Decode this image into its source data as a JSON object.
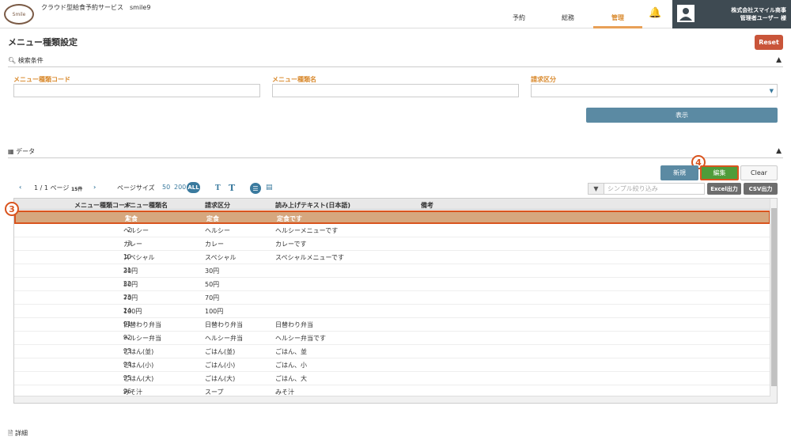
{
  "header": {
    "logo_text": "Smile",
    "app_title": "クラウド型給食予約サービス　smile9",
    "nav": [
      "予約",
      "総務",
      "管理"
    ],
    "active_nav": "管理",
    "company": "株式会社スマイル商事",
    "user": "管理者ユーザー 様"
  },
  "page": {
    "title": "メニュー種類設定",
    "reset_label": "Reset"
  },
  "search": {
    "section_title": "検索条件",
    "fields": [
      {
        "label": "メニュー種類コード",
        "value": ""
      },
      {
        "label": "メニュー種類名",
        "value": ""
      },
      {
        "label": "請求区分",
        "value": ""
      }
    ],
    "show_label": "表示"
  },
  "data_section": {
    "title": "データ",
    "new_label": "新規",
    "edit_label": "編集",
    "clear_label": "Clear",
    "callouts": [
      "3",
      "4"
    ],
    "pager_text": "1 / 1 ページ",
    "count_text": "15件",
    "page_size_label": "ページサイズ",
    "page_sizes": [
      "50",
      "200",
      "ALL"
    ],
    "filter_placeholder": "シンプル絞り込み",
    "excel_label": "Excel出力",
    "csv_label": "CSV出力"
  },
  "table": {
    "columns": [
      "メニュー種類コード",
      "メニュー種類名",
      "請求区分",
      "読み上げテキスト(日本語)",
      "備考"
    ],
    "rows": [
      [
        "1",
        "定食",
        "定食",
        "定食です",
        ""
      ],
      [
        "2",
        "ヘルシー",
        "ヘルシー",
        "ヘルシーメニューです",
        ""
      ],
      [
        "3",
        "カレー",
        "カレー",
        "カレーです",
        ""
      ],
      [
        "10",
        "スペシャル",
        "スペシャル",
        "スペシャルメニューです",
        ""
      ],
      [
        "21",
        "30円",
        "30円",
        "",
        ""
      ],
      [
        "22",
        "50円",
        "50円",
        "",
        ""
      ],
      [
        "23",
        "70円",
        "70円",
        "",
        ""
      ],
      [
        "24",
        "100円",
        "100円",
        "",
        ""
      ],
      [
        "91",
        "日替わり弁当",
        "日替わり弁当",
        "日替わり弁当",
        ""
      ],
      [
        "92",
        "ヘルシー弁当",
        "ヘルシー弁当",
        "ヘルシー弁当です",
        ""
      ],
      [
        "93",
        "ごはん(並)",
        "ごはん(並)",
        "ごはん、並",
        ""
      ],
      [
        "94",
        "ごはん(小)",
        "ごはん(小)",
        "ごはん、小",
        ""
      ],
      [
        "95",
        "ごはん(大)",
        "ごはん(大)",
        "ごはん、大",
        ""
      ],
      [
        "96",
        "みそ汁",
        "スープ",
        "みそ汁",
        ""
      ]
    ],
    "selected_index": 0
  },
  "detail": {
    "title": "詳細"
  }
}
